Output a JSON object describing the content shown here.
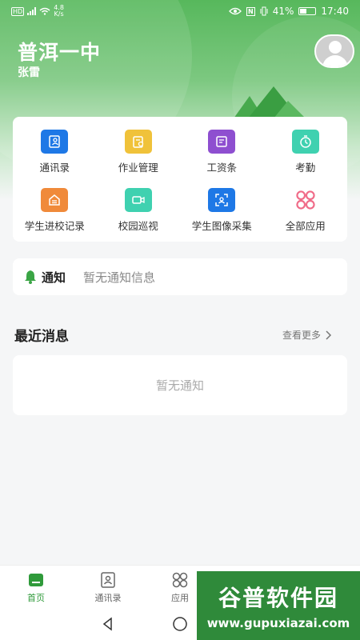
{
  "status_bar": {
    "speed_top": "4.8",
    "speed_unit": "K/s",
    "battery": "41%",
    "time": "17:40"
  },
  "header": {
    "school_name": "普洱一中",
    "user_name": "张雷"
  },
  "apps": [
    {
      "label": "通讯录",
      "icon": "contacts-icon",
      "color": "#1e78e6"
    },
    {
      "label": "作业管理",
      "icon": "homework-icon",
      "color": "#f0c23a"
    },
    {
      "label": "工资条",
      "icon": "payslip-icon",
      "color": "#8e4fd0"
    },
    {
      "label": "考勤",
      "icon": "attendance-icon",
      "color": "#3fd1b0"
    },
    {
      "label": "学生进校记录",
      "icon": "entry-record-icon",
      "color": "#f08a3a"
    },
    {
      "label": "校园巡视",
      "icon": "patrol-icon",
      "color": "#3fd1b0"
    },
    {
      "label": "学生图像采集",
      "icon": "face-capture-icon",
      "color": "#1e78e6"
    },
    {
      "label": "全部应用",
      "icon": "all-apps-icon",
      "color": "#f06b88"
    }
  ],
  "notice": {
    "title": "通知",
    "message": "暂无通知信息"
  },
  "recent": {
    "title": "最近消息",
    "more": "查看更多",
    "empty": "暂无通知"
  },
  "tabbar": [
    {
      "label": "首页",
      "active": true
    },
    {
      "label": "通讯录",
      "active": false
    },
    {
      "label": "应用",
      "active": false
    },
    {
      "label": "",
      "active": false
    },
    {
      "label": "",
      "active": false
    }
  ],
  "watermark": {
    "name": "谷普软件园",
    "url": "www.gupuxiazai.com"
  },
  "colors": {
    "primary": "#4cb050",
    "active_tab": "#2f9a3a"
  }
}
